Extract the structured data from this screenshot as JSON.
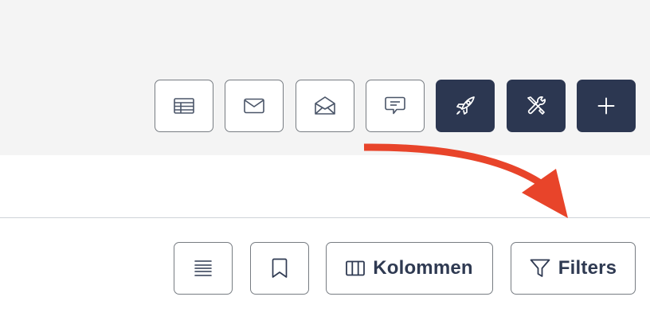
{
  "toolbar_top": {
    "buttons": [
      {
        "icon": "table-icon"
      },
      {
        "icon": "mail-icon"
      },
      {
        "icon": "mail-open-icon"
      },
      {
        "icon": "comment-icon"
      },
      {
        "icon": "rocket-icon"
      },
      {
        "icon": "tools-icon"
      },
      {
        "icon": "plus-icon"
      }
    ]
  },
  "toolbar_bottom": {
    "columns_label": "Kolommen",
    "filters_label": "Filters"
  },
  "colors": {
    "accent_dark": "#2c3751",
    "annotation_arrow": "#e8442a",
    "top_band": "#f4f4f4"
  }
}
